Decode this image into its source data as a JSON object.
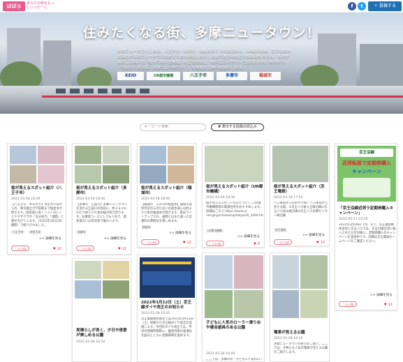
{
  "header": {
    "logo": "ぽぽら",
    "logo_sub": "あなたの街をもっとハッピーに",
    "fb": "f",
    "tw": "t",
    "post_button": "＋ 投稿する"
  },
  "hero": {
    "title": "住みたくなる街、多摩ニュータウン！",
    "description": "多摩ニュータウンにある、八王子市・多摩市・稲城市の３つの自治体と、UR都市機構、京王電鉄株式会社が多摩ニュータウンのおすすめを発信します！公園や遊び場などの情報はもちろん、各市が暮らしに関する「知って得する情報」なども発信し、他の口コミサイトでは見られないお得かつ、「住みたくなる街、多摩ニュータウン！」な情報を皆様へお届けします。",
    "logos": [
      "KEIO",
      "UR都市機構",
      "八王子市",
      "多摩市",
      "稲城市"
    ]
  },
  "search": {
    "placeholder": "キーワード検索",
    "filter_label": "表示する投稿の絞込み"
  },
  "cards": [
    {
      "title": "桜が見えるスポット紹介（八王子市）",
      "date": "2022-03-18 18:49",
      "body": "【八王子市　帝京大学】帝京大学前からの、東京都立大学前駅まで桜並木が続きます。遊歩道に咲くソメイヨシノとヤマザクラが「五分咲き」「満開」と春を告げています。（2022年3月22日撮影）で紹介されました。",
      "tags": [
        "八王子市",
        "帝京大学"
      ],
      "more": ">> 詳細を見る",
      "like": "いいね!",
      "count": "12"
    },
    {
      "title": "桜が見えるスポット紹介（多摩市）",
      "date": "2022-03-18 18:46",
      "body": "【多摩市　乞田川】多摩ニュータウンを流れる乞田川の両岸に、約３ｋｍにわたり約５００本の桜が咲き誇ります。お散歩コースとしても人気で、遊歩道沿いは花見客で賑わいます。",
      "tags": [
        "多摩市"
      ],
      "more": ">> 詳細を見る",
      "like": "いいね!",
      "count": "12"
    },
    {
      "title": "桜が見えるスポット紹介（稲城市）",
      "date": "2022-03-18 18:40",
      "body": "【稲城市　三沢川の桜並木】稲城市役所付近の三沢川沿いの遊歩道には約２００本の桜並木が続きます。夜はライトアップされ、昼間とはまた違った幻想的な雰囲気を楽しめます。",
      "tags": [
        "稲城市"
      ],
      "more": ">> 詳細を見る",
      "like": "いいね!",
      "count": "12"
    },
    {
      "title": "桜が見えるスポット紹介（UR都市機構）",
      "date": "2022-03-18 18:36",
      "body": "桜が見えるスポットのひとつとしてUR都市機構管理の賃貸住宅をおすすめします。詳細はこちら https://www.ur-net.go.jp/chintai/sp/tokyo/20_4340.html",
      "tags": [
        "UR都市機構"
      ],
      "more": ">> 詳細を見る",
      "like": "いいね!",
      "count": "8"
    },
    {
      "title": "桜が見えるスポット紹介（京王電鉄）",
      "date": "2022-03-18 17:54",
      "body": "バス車窓からのおすすめ！バス車窓から見える桜。①京王バス桜ヶ丘線沿線②京王バス永山線沿線③京王バス多摩センター線沿線",
      "tags": [
        "京王電鉄"
      ],
      "more": ">> 詳細を見る",
      "like": "いいね!",
      "count": "10"
    },
    {
      "title": "「京王沿線近郊ラ定期券購入キャンペーン」",
      "date": "2022-03-11 15:16",
      "body": "2022年3月28日（月）まで、京王電鉄株式会社と京王バスでは、京王沿線近郊に転入された方を対象に、定期券購入のキャンペーンを実施中です。詳細は京王電鉄ホームページをご確認ください。",
      "tags": [],
      "more": ">> 詳細を見る",
      "like": "いいね!",
      "count": "12"
    },
    {
      "title": "見晴らしが良く、夕日や夜景が美しめる公園",
      "date": "2022-02-28 16:10",
      "body": "",
      "tags": [],
      "more": "",
      "like": "",
      "count": ""
    },
    {
      "title": "2022年3月12日（土）京王線ダイヤ改正のお知らせ",
      "date": "2022-02-28 16:05",
      "body": "京王電鉄株式会社では2022年3月12日（土）始発から京王線ダイヤ改正を実施します。今回のダイヤ改正では、平日の夜間時間帯に、優等列車の速達化を図るとともに混雑緩和を進めます。",
      "tags": [],
      "more": "",
      "like": "",
      "count": ""
    },
    {
      "title": "子どもに人気のローラー滑り台や複合遊具のある公園",
      "date": "2022-02-28 16:00",
      "body": "ここでは、多摩市の「子どもに人気のローラー滑り台」",
      "tags": [],
      "more": "",
      "like": "",
      "count": ""
    },
    {
      "title": "電車が見える公園",
      "date": "2022-02-28 16:19",
      "body": "多摩ニュータウンの各市をご紹介。ここでは、子供に大人気の電車が見える公園をご紹介します。",
      "tags": [],
      "more": "",
      "like": "",
      "count": ""
    }
  ],
  "ad": {
    "top": "京王沿線",
    "headline": "近郊転居で定期券購入",
    "sub": "キャンペーン"
  },
  "colors": {
    "accent": "#1f6fb5",
    "like": "#d6425b",
    "logo": "#e85b8c"
  }
}
